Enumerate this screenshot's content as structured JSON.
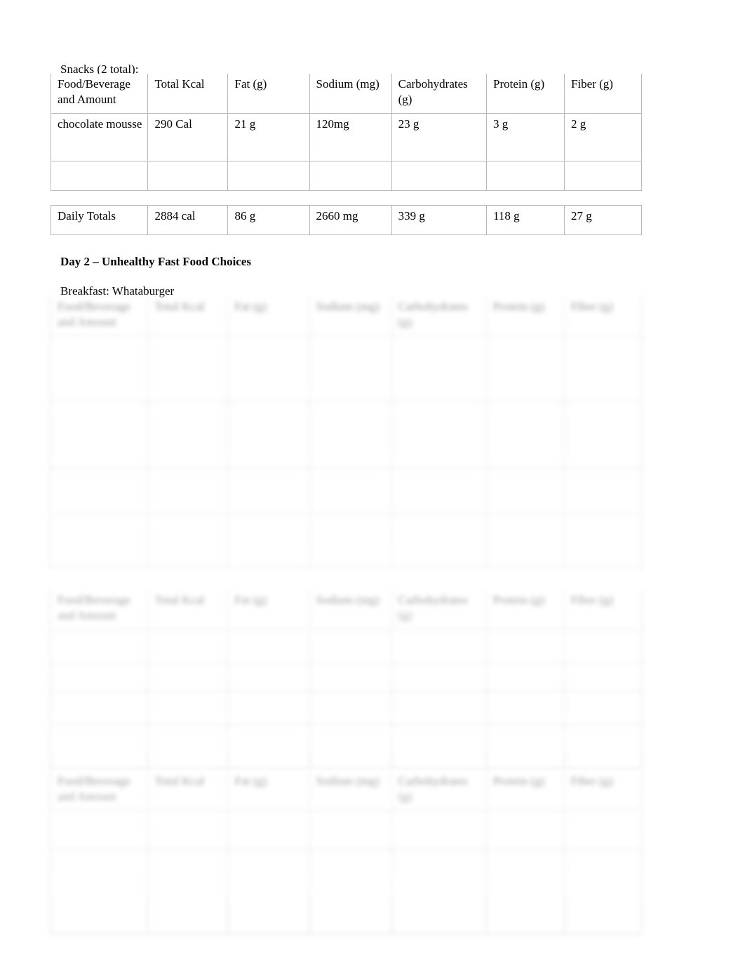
{
  "document": {
    "type": "nutrition-log",
    "page_background": "#ffffff",
    "text_color": "#000000",
    "rule_color": "#b9b9b9"
  },
  "columns": {
    "headers": [
      "Food/Beverage and Amount",
      "Total Kcal",
      "Fat (g)",
      "Sodium (mg)",
      "Carbohydrates (g)",
      "Protein (g)",
      "Fiber (g)"
    ]
  },
  "snacks_section": {
    "caption": "Snacks (2 total):",
    "table": {
      "headers": [
        "Food/Beverage and Amount",
        "Total Kcal",
        "Fat (g)",
        "Sodium (mg)",
        "Carbohydrates (g)",
        "Protein (g)",
        "Fiber (g)"
      ],
      "rows": [
        {
          "food": "chocolate mousse",
          "kcal": "290 Cal",
          "fat": "21 g",
          "sodium": "120mg",
          "carbs": "23 g",
          "protein": "3 g",
          "fiber": "2 g"
        },
        {
          "food": "",
          "kcal": "",
          "fat": "",
          "sodium": "",
          "carbs": "",
          "protein": "",
          "fiber": ""
        }
      ]
    }
  },
  "daily_totals": {
    "table": {
      "row": {
        "food": "Daily Totals",
        "kcal": "2884 cal",
        "fat": "86 g",
        "sodium": "2660 mg",
        "carbs": "339 g",
        "protein": "118 g",
        "fiber": "27 g"
      }
    }
  },
  "day2": {
    "heading": "Day 2 – Unhealthy Fast Food Choices",
    "breakfast": {
      "caption": "Breakfast: Whataburger",
      "table": {
        "headers": [
          "Food/Beverage and Amount",
          "Total Kcal",
          "Fat (g)",
          "Sodium (mg)",
          "Carbohydrates (g)",
          "Protein (g)",
          "Fiber (g)"
        ],
        "redacted": true,
        "row_count": 4,
        "rows": [
          {
            "food": "",
            "kcal": "",
            "fat": "",
            "sodium": "",
            "carbs": "",
            "protein": "",
            "fiber": ""
          },
          {
            "food": "",
            "kcal": "",
            "fat": "",
            "sodium": "",
            "carbs": "",
            "protein": "",
            "fiber": ""
          },
          {
            "food": "",
            "kcal": "",
            "fat": "",
            "sodium": "",
            "carbs": "",
            "protein": "",
            "fiber": ""
          },
          {
            "food": "",
            "kcal": "",
            "fat": "",
            "sodium": "",
            "carbs": "",
            "protein": "",
            "fiber": ""
          }
        ]
      }
    },
    "lunch": {
      "caption": "",
      "table": {
        "headers": [
          "Food/Beverage and Amount",
          "Total Kcal",
          "Fat (g)",
          "Sodium (mg)",
          "Carbohydrates (g)",
          "Protein (g)",
          "Fiber (g)"
        ],
        "redacted": true,
        "row_count": 4,
        "rows": [
          {
            "food": "",
            "kcal": "",
            "fat": "",
            "sodium": "",
            "carbs": "",
            "protein": "",
            "fiber": ""
          },
          {
            "food": "",
            "kcal": "",
            "fat": "",
            "sodium": "",
            "carbs": "",
            "protein": "",
            "fiber": ""
          },
          {
            "food": "",
            "kcal": "",
            "fat": "",
            "sodium": "",
            "carbs": "",
            "protein": "",
            "fiber": ""
          },
          {
            "food": "",
            "kcal": "",
            "fat": "",
            "sodium": "",
            "carbs": "",
            "protein": "",
            "fiber": ""
          }
        ]
      }
    },
    "dinner": {
      "caption": "",
      "table": {
        "headers": [
          "Food/Beverage and Amount",
          "Total Kcal",
          "Fat (g)",
          "Sodium (mg)",
          "Carbohydrates (g)",
          "Protein (g)",
          "Fiber (g)"
        ],
        "redacted": true,
        "row_count": 2,
        "rows": [
          {
            "food": "",
            "kcal": "",
            "fat": "",
            "sodium": "",
            "carbs": "",
            "protein": "",
            "fiber": ""
          },
          {
            "food": "",
            "kcal": "",
            "fat": "",
            "sodium": "",
            "carbs": "",
            "protein": "",
            "fiber": ""
          }
        ]
      }
    }
  }
}
